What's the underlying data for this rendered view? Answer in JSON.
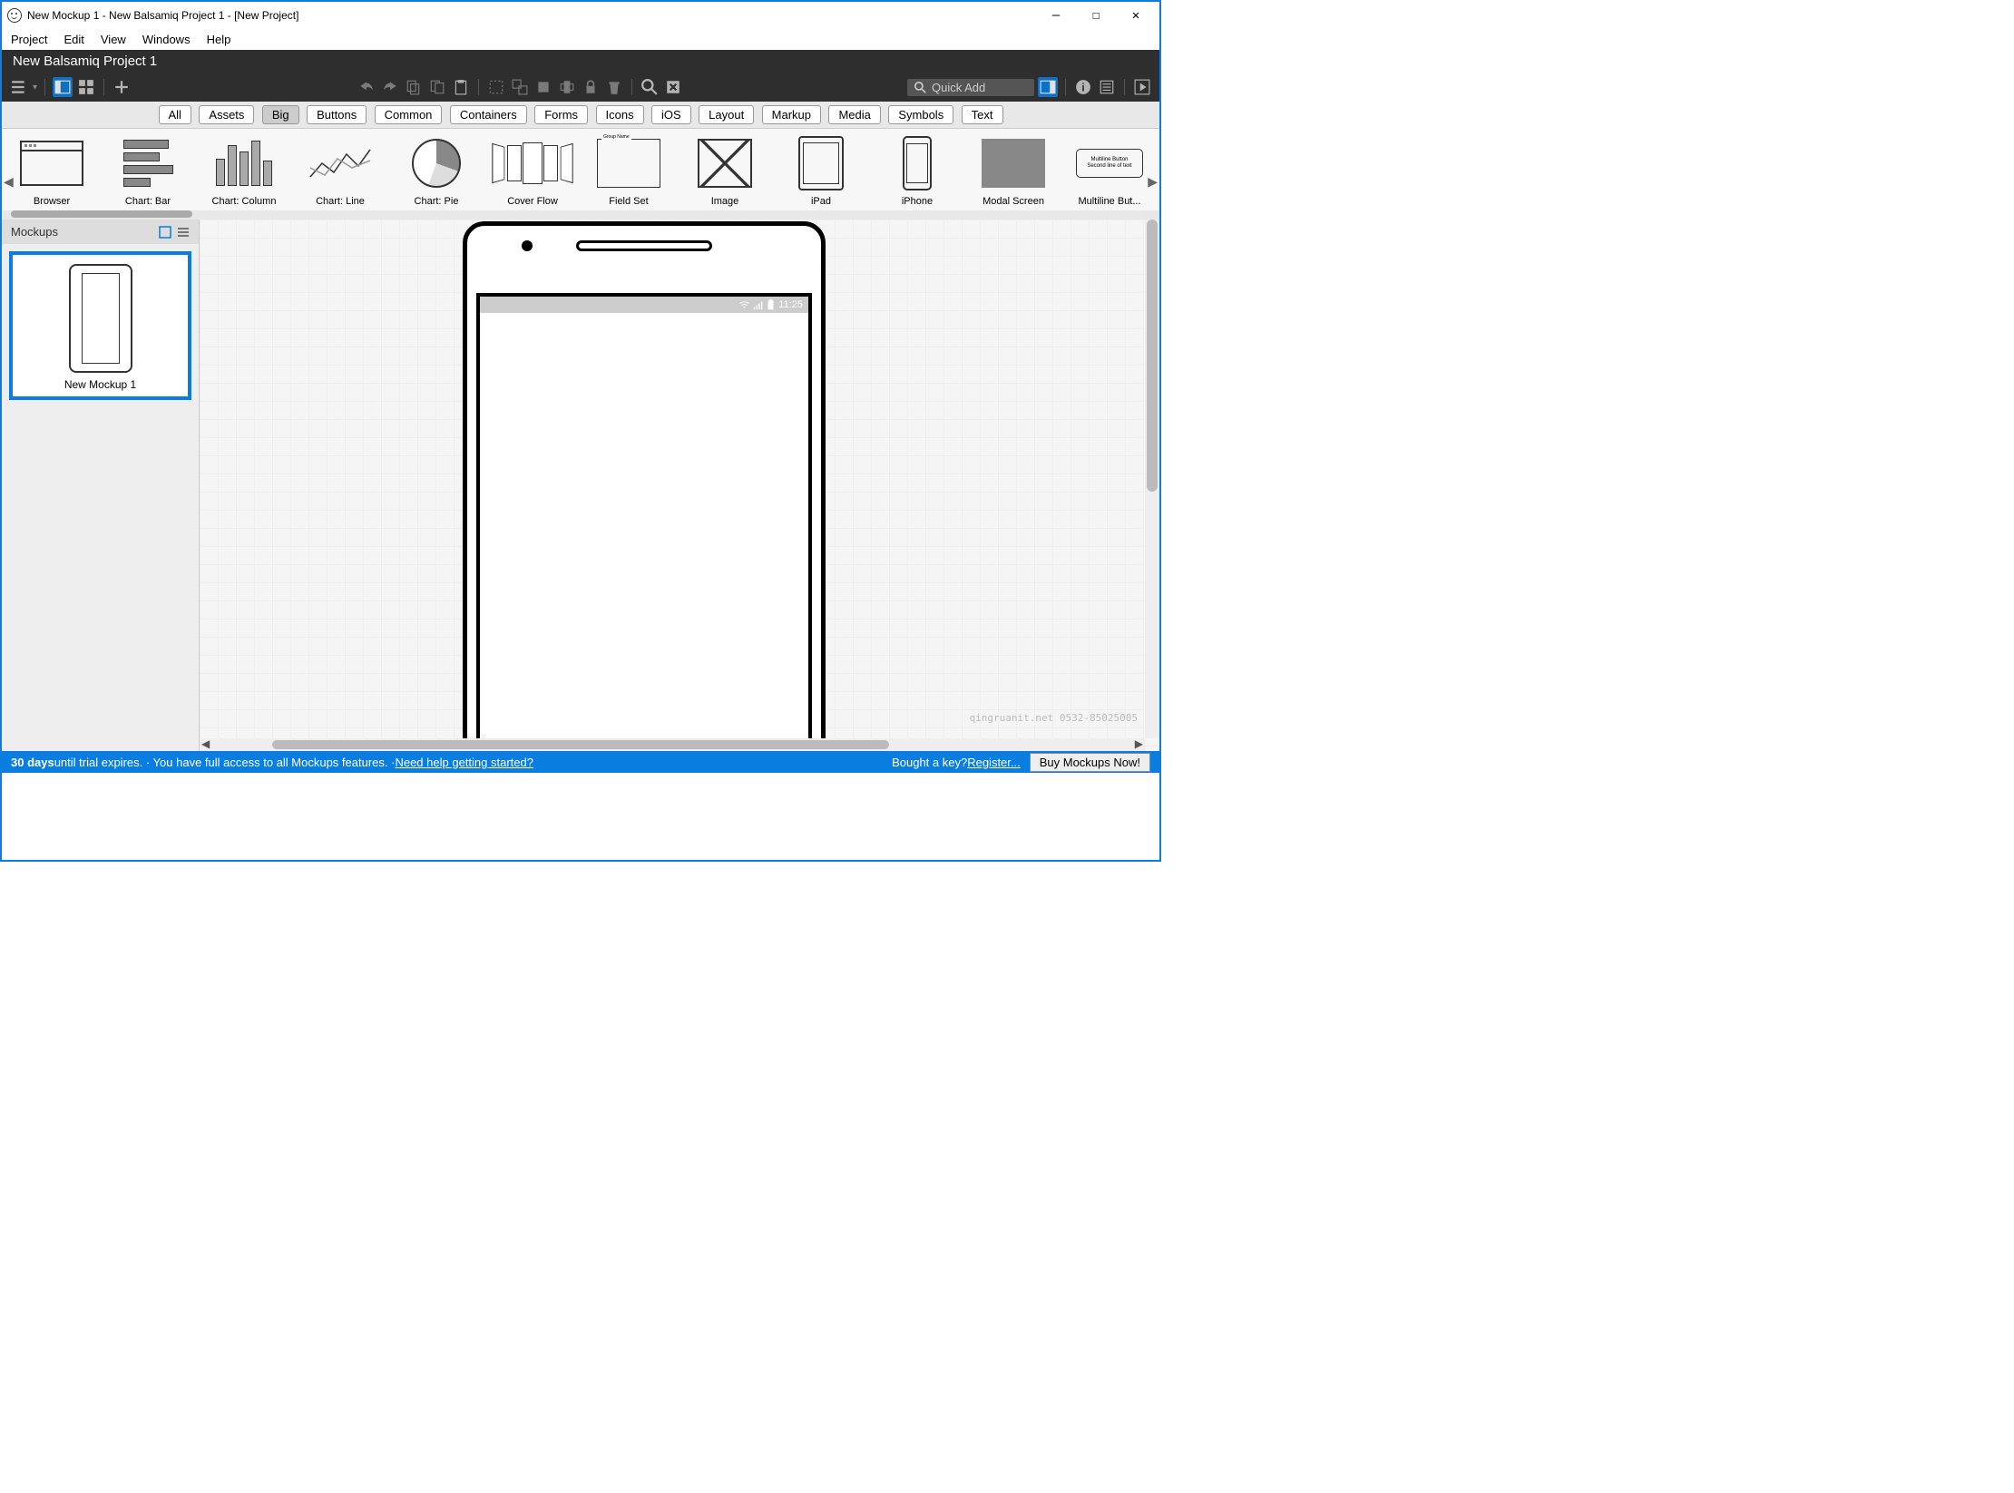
{
  "titlebar": {
    "title": "New Mockup 1 - New Balsamiq Project 1 - [New Project]"
  },
  "menu": {
    "project": "Project",
    "edit": "Edit",
    "view": "View",
    "windows": "Windows",
    "help": "Help"
  },
  "projectHeader": "New Balsamiq Project 1",
  "quickadd": {
    "placeholder": "Quick Add"
  },
  "categories": {
    "all": "All",
    "assets": "Assets",
    "big": "Big",
    "buttons": "Buttons",
    "common": "Common",
    "containers": "Containers",
    "forms": "Forms",
    "icons": "Icons",
    "ios": "iOS",
    "layout": "Layout",
    "markup": "Markup",
    "media": "Media",
    "symbols": "Symbols",
    "text": "Text"
  },
  "library": {
    "browser": "Browser",
    "chartBar": "Chart: Bar",
    "chartColumn": "Chart: Column",
    "chartLine": "Chart: Line",
    "chartPie": "Chart: Pie",
    "coverFlow": "Cover Flow",
    "fieldSet": "Field Set",
    "image": "Image",
    "ipad": "iPad",
    "iphone": "iPhone",
    "modal": "Modal Screen",
    "multiline": "Multiline But...",
    "multilineBtn1": "Multiline Button",
    "multilineBtn2": "Second line of text"
  },
  "navigator": {
    "title": "Mockups",
    "item1": "New Mockup 1"
  },
  "canvas": {
    "statusTime": "11:25"
  },
  "statusbar": {
    "bold": "30 days",
    "trial": " until trial expires.  ·  You have full access to all Mockups features.  ·  ",
    "help": "Need help getting started?",
    "bought": "Bought a key? ",
    "register": "Register...",
    "buy": "Buy Mockups Now!"
  },
  "watermark": "qingruanit.net 0532-85025005"
}
